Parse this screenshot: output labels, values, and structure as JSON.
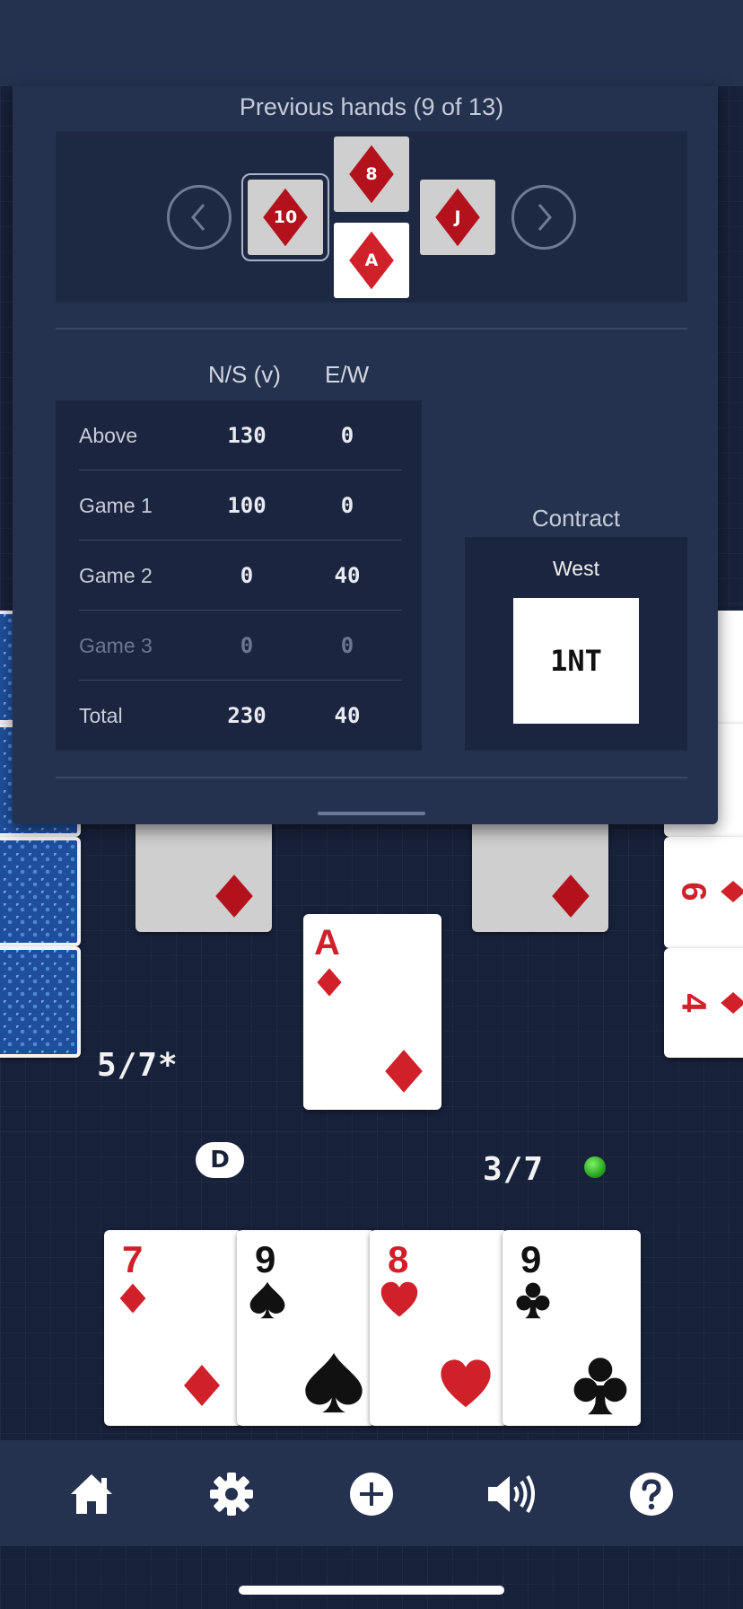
{
  "panel": {
    "title": "Previous hands (9 of 13)",
    "trick": {
      "north": {
        "rank": "8"
      },
      "west": {
        "rank": "10"
      },
      "east": {
        "rank": "J"
      },
      "south": {
        "rank": "A"
      }
    }
  },
  "score": {
    "headers": {
      "ns": "N/S (v)",
      "ew": "E/W"
    },
    "rows": [
      {
        "label": "Above",
        "ns": "130",
        "ew": "0"
      },
      {
        "label": "Game 1",
        "ns": "100",
        "ew": "0"
      },
      {
        "label": "Game 2",
        "ns": "0",
        "ew": "40"
      },
      {
        "label": "Game 3",
        "ns": "0",
        "ew": "0"
      },
      {
        "label": "Total",
        "ns": "230",
        "ew": "40"
      }
    ]
  },
  "contract": {
    "label": "Contract",
    "declarer": "West",
    "bid": "1NT"
  },
  "table": {
    "played_south": {
      "rank": "A"
    },
    "score_left": "5/7*",
    "score_right": "3/7",
    "dealer_badge": "D",
    "east_hand": [
      {
        "rank": "6"
      },
      {
        "rank": "4"
      }
    ]
  },
  "hand": [
    {
      "rank": "7",
      "suit": "diamond"
    },
    {
      "rank": "9",
      "suit": "spade"
    },
    {
      "rank": "8",
      "suit": "heart"
    },
    {
      "rank": "9",
      "suit": "club"
    }
  ],
  "colors": {
    "red": "#d0212a",
    "panel": "#25324f",
    "table": "#17213a"
  },
  "bottom_nav": [
    {
      "icon": "home-icon"
    },
    {
      "icon": "gear-icon"
    },
    {
      "icon": "plus-circle-icon"
    },
    {
      "icon": "speaker-icon"
    },
    {
      "icon": "help-icon"
    }
  ]
}
